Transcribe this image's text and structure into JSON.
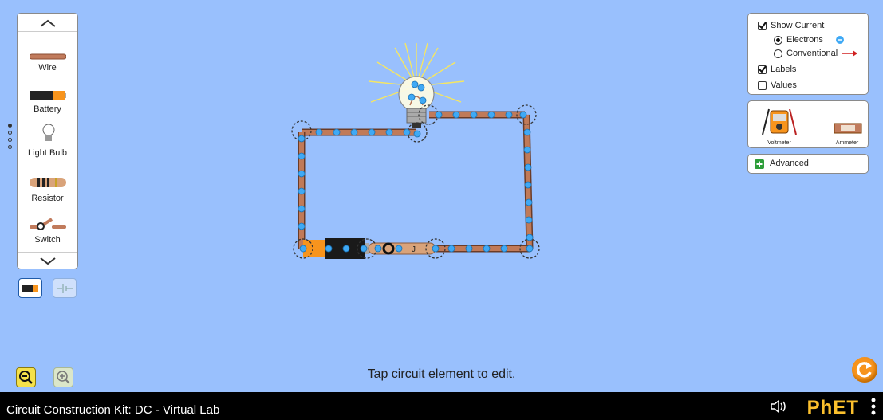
{
  "toolbox": {
    "items": [
      {
        "label": "Wire"
      },
      {
        "label": "Battery"
      },
      {
        "label": "Light Bulb"
      },
      {
        "label": "Resistor"
      },
      {
        "label": "Switch"
      }
    ],
    "up_icon": "chevron-up-icon",
    "down_icon": "chevron-down-icon"
  },
  "view_toggle": {
    "lifelike_icon": "battery-icon",
    "schematic_icon": "schematic-battery-icon"
  },
  "display_options": {
    "show_current": {
      "label": "Show Current",
      "checked": true
    },
    "electrons": {
      "label": "Electrons",
      "selected": true
    },
    "conventional": {
      "label": "Conventional",
      "selected": false
    },
    "labels": {
      "label": "Labels",
      "checked": true
    },
    "values": {
      "label": "Values",
      "checked": false
    }
  },
  "sensors": {
    "voltmeter": "Voltmeter",
    "ammeter": "Ammeter"
  },
  "advanced": {
    "label": "Advanced"
  },
  "hint": "Tap circuit element to edit.",
  "footer": {
    "title": "Circuit Construction Kit: DC - Virtual Lab",
    "logo": "PhET"
  },
  "colors": {
    "background": "#99c0fd",
    "electron": "#3fa9f5",
    "wire": "#b87456",
    "accent": "#f7941d"
  }
}
